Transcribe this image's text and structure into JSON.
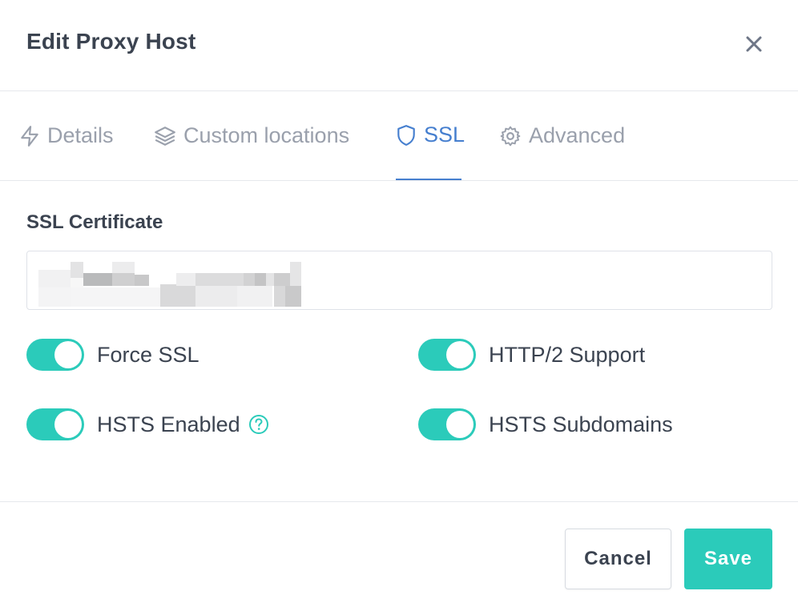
{
  "modal": {
    "title": "Edit Proxy Host"
  },
  "tabs": [
    {
      "label": "Details",
      "icon": "bolt-icon",
      "active": false
    },
    {
      "label": "Custom locations",
      "icon": "layers-icon",
      "active": false
    },
    {
      "label": "SSL",
      "icon": "shield-icon",
      "active": true
    },
    {
      "label": "Advanced",
      "icon": "gear-icon",
      "active": false
    }
  ],
  "ssl": {
    "certificate_label": "SSL Certificate",
    "certificate_value_obscured": true,
    "toggles": [
      {
        "label": "Force SSL",
        "checked": true
      },
      {
        "label": "HTTP/2 Support",
        "checked": true
      },
      {
        "label": "HSTS Enabled",
        "checked": true,
        "help_icon": "question-circle-icon"
      },
      {
        "label": "HSTS Subdomains",
        "checked": true
      }
    ]
  },
  "footer": {
    "cancel_label": "Cancel",
    "save_label": "Save"
  },
  "colors": {
    "accent_teal": "#2bcbba",
    "active_tab_blue": "#467fcf",
    "muted_text": "#9aa0ac",
    "heading_text": "#3b4350",
    "border": "#e6e8ec"
  }
}
